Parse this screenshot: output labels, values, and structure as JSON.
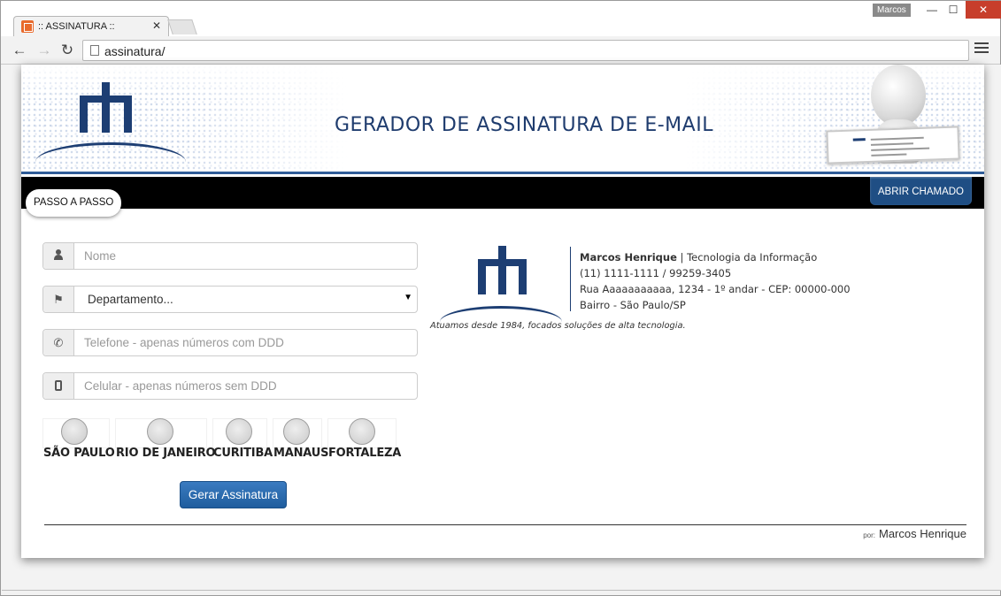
{
  "browser": {
    "tab_title": ":: ASSINATURA ::",
    "tab_close": "✕",
    "user_badge": "Marcos",
    "url": "assinatura/",
    "window": {
      "minimize": "—",
      "maximize": "☐",
      "close": "✕"
    },
    "nav": {
      "back": "←",
      "forward": "→",
      "reload": "↻"
    }
  },
  "header": {
    "title": "GERADOR DE ASSINATURA DE E-MAIL",
    "brand_color": "#1d3e73"
  },
  "navbar": {
    "step_pill": "PASSO A PASSO",
    "support_button": "ABRIR CHAMADO"
  },
  "form": {
    "name_placeholder": "Nome",
    "department_selected": "Departamento...",
    "phone_placeholder": "Telefone - apenas números com DDD",
    "mobile_placeholder": "Celular - apenas números sem DDD",
    "cities": [
      "SÃO PAULO",
      "RIO DE JANEIRO",
      "CURITIBA",
      "MANAUS",
      "FORTALEZA"
    ],
    "submit_label": "Gerar Assinatura"
  },
  "signature": {
    "name": "Marcos Henrique",
    "department": "| Tecnologia da Informação",
    "phones": "(11) 1111-1111 / 99259-3405",
    "address": "Rua Aaaaaaaaaaa, 1234 - 1º andar - CEP: 00000-000",
    "district": "Bairro - São Paulo/SP",
    "tagline": "Atuamos desde 1984, focados soluções de alta tecnologia."
  },
  "footer": {
    "prefix": "por:",
    "author": "Marcos Henrique"
  }
}
